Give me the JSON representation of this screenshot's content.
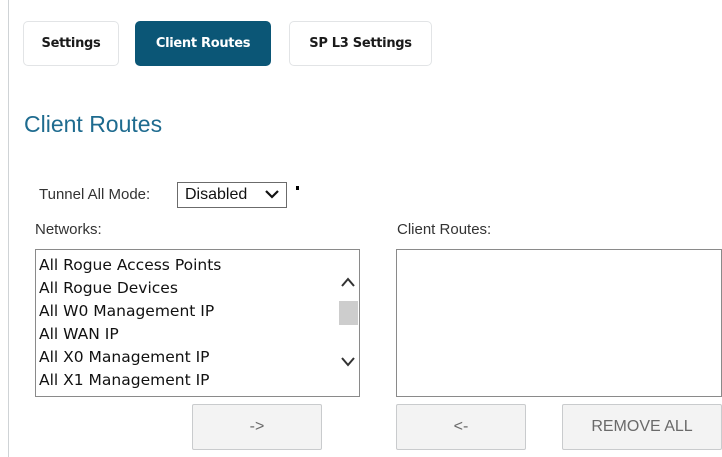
{
  "tabs": [
    {
      "label": "Settings"
    },
    {
      "label": "Client Routes"
    },
    {
      "label": "SP L3 Settings"
    }
  ],
  "active_tab": "Client Routes",
  "section_title": "Client Routes",
  "tunnel_all_mode": {
    "label": "Tunnel All Mode:",
    "value": "Disabled"
  },
  "networks": {
    "label": "Networks:",
    "items": [
      "All Rogue Access Points",
      "All Rogue Devices",
      "All W0 Management IP",
      "All WAN IP",
      "All X0 Management IP",
      "All X1 Management IP"
    ]
  },
  "client_routes": {
    "label": "Client Routes:",
    "items": []
  },
  "buttons": {
    "add": "->",
    "remove": "<-",
    "remove_all": "REMOVE ALL"
  },
  "icons": {
    "dropdown": "chevron-down-icon",
    "scroll_up": "chevron-up-icon",
    "scroll_down": "chevron-down-icon"
  },
  "colors": {
    "active_tab": "#0b5676",
    "title": "#1e6b8f"
  }
}
